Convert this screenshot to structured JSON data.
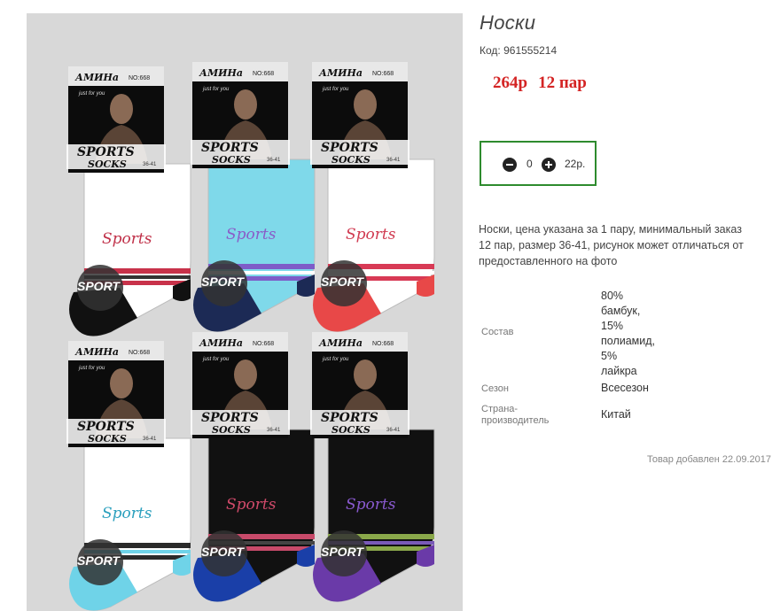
{
  "product": {
    "title": "Носки",
    "code_label": "Код:",
    "code": "961555214",
    "price": "264р",
    "pack": "12 пар",
    "quantity": "0",
    "total": "22р.",
    "description": "Носки, цена указана за 1 пару, минимальный заказ 12 пар, размер 36-41, рисунок может отличаться от предоставленного на фото",
    "added": "Товар добавлен 22.09.2017"
  },
  "specs": {
    "composition_label": "Состав",
    "composition_lines": [
      "80%",
      "бамбук,",
      "15%",
      "полиамид,",
      "5%",
      "лайкра"
    ],
    "season_label": "Сезон",
    "season_value": "Всесезон",
    "country_label_lines": [
      "Страна-",
      "производитель"
    ],
    "country_value": "Китай"
  },
  "photo": {
    "socks": [
      {
        "body": "#ffffff",
        "cuff": "#ffffff",
        "toe": "#111111",
        "stripe1": "#c8324a",
        "stripe2": "#333333",
        "text_color": "#c03048"
      },
      {
        "body": "#7fd9ea",
        "cuff": "#7fd9ea",
        "toe": "#1c2a55",
        "stripe1": "#7e5cc8",
        "stripe2": "#ffffff",
        "text_color": "#8a5cc8"
      },
      {
        "body": "#ffffff",
        "cuff": "#ffffff",
        "toe": "#e84848",
        "stripe1": "#d83a55",
        "stripe2": "#ffffff",
        "text_color": "#d03a50"
      },
      {
        "body": "#ffffff",
        "cuff": "#ffffff",
        "toe": "#6fd3e8",
        "stripe1": "#2a2a2a",
        "stripe2": "#6fd3e8",
        "text_color": "#2a9fbd"
      },
      {
        "body": "#111111",
        "cuff": "#111111",
        "toe": "#1a3fa8",
        "stripe1": "#c84a6a",
        "stripe2": "#444444",
        "text_color": "#d04a6a"
      },
      {
        "body": "#111111",
        "cuff": "#111111",
        "toe": "#6a3aa8",
        "stripe1": "#8aa84a",
        "stripe2": "#7a5ab8",
        "text_color": "#8a5ad0"
      }
    ],
    "brand": "АМИНа",
    "tagline": "just for you",
    "model_no": "NO:668",
    "pack_line1": "SPORTS",
    "pack_line2": "SOCKS",
    "size": "36-41",
    "sock_text": "Sports",
    "badge_text": "SPORT"
  }
}
